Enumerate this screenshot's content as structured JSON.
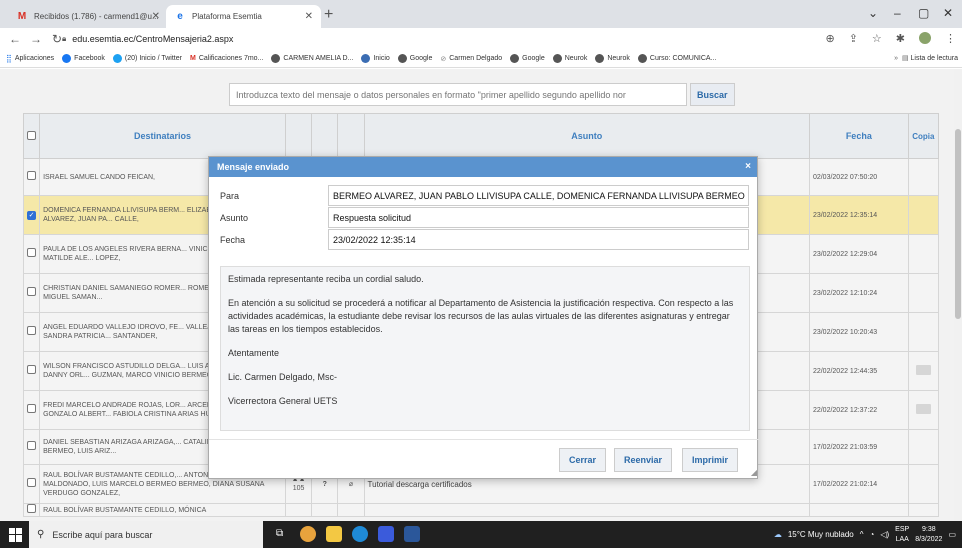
{
  "browser": {
    "tabs": [
      {
        "title": "Recibidos (1.786) - carmend1@u...",
        "active": false
      },
      {
        "title": "Plataforma Esemtia",
        "active": true
      }
    ],
    "url": "edu.esemtia.ec/CentroMensajeria2.aspx",
    "bookmarks": [
      "Aplicaciones",
      "Facebook",
      "(20) Inicio / Twitter",
      "Calificaciones 7mo...",
      "CARMEN AMELIA D...",
      "Inicio",
      "Google",
      "Carmen Delgado",
      "Google",
      "Neurok",
      "Neurok",
      "Curso: COMUNICA..."
    ],
    "reading_list": "Lista de lectura",
    "new_tab_symbol": "+",
    "window_controls": [
      "⌄",
      "–",
      "▢",
      "✕"
    ]
  },
  "search": {
    "placeholder": "Introduzca texto del mensaje o datos personales en formato \"primer apellido segundo apellido nor",
    "button": "Buscar"
  },
  "table": {
    "headers": {
      "recipients": "Destinatarios",
      "subject": "Asunto",
      "date": "Fecha",
      "copy": "Copia"
    },
    "rows": [
      {
        "names": "ISRAEL SAMUEL CANDO FEICAN,",
        "date": "02/03/2022 07:50:20",
        "selected": false,
        "env": false
      },
      {
        "names": "DOMENICA FERNANDA LLIVISUPA BERM... ELIZABETH BERMEO ALVAREZ, JUAN PA... CALLE,",
        "date": "23/02/2022 12:35:14",
        "selected": true,
        "env": false
      },
      {
        "names": "PAULA DE LOS ANGELES RIVERA BERNA... VINICIO RIVERA MEDINA, MATILDE ALE... LOPEZ,",
        "date": "23/02/2022 12:29:04",
        "selected": false,
        "env": false
      },
      {
        "names": "CHRISTIAN DANIEL SAMANIEGO ROMER... ROMERO LOJA, MARCO MIGUEL SAMAN...",
        "date": "23/02/2022 12:10:24",
        "selected": false,
        "env": false
      },
      {
        "names": "ANGEL EDUARDO VALLEJO IDROVO, FE... VALLEJO SIGUENCIA, SANDRA PATRICIA... SANTANDER,",
        "date": "23/02/2022 10:20:43",
        "selected": false,
        "env": false
      },
      {
        "names": "WILSON FRANCISCO ASTUDILLO DELGA... LUIS AVILA CAMPOVERDE, DANNY ORL... GUZMAN, MARCO VINICIO BERMEO DIA...",
        "date": "22/02/2022 12:44:35",
        "selected": false,
        "env": true
      },
      {
        "names": "FREDI MARCELO ANDRADE ROJAS, LOR... ARCENTALES AVILES, GONZALO ALBERT... FABIOLA CRISTINA ARIAS HUGO, WILSC...",
        "date": "22/02/2022 12:37:22",
        "selected": false,
        "env": true
      },
      {
        "names": "DANIEL SEBASTIAN ARIZAGA ARIZAGA,... CATALINA ARIZAGA BERMEO, LUIS ARIZ...",
        "date": "17/02/2022 21:03:59",
        "selected": false,
        "env": false
      },
      {
        "names": "RAUL BOLÍVAR BUSTAMANTE CEDILLO,... ANTONIA ARICHÁVALA MALDONADO, LUIS MARCELO BERMEO BERMEO, DIANA SUSANA VERDUGO GONZALEZ,",
        "date": "17/02/2022 21:02:14",
        "selected": false,
        "env": false,
        "count": "105",
        "subject": "Tutorial descarga certificados"
      },
      {
        "names": "RAUL BOLÍVAR BUSTAMANTE CEDILLO, MÓNICA",
        "date": "",
        "selected": false,
        "env": false
      }
    ]
  },
  "modal": {
    "title": "Mensaje enviado",
    "close": "×",
    "labels": {
      "to": "Para",
      "subject": "Asunto",
      "date": "Fecha"
    },
    "to": "BERMEO ALVAREZ, JUAN PABLO LLIVISUPA CALLE, DOMENICA FERNANDA LLIVISUPA BERMEO",
    "subject": "Respuesta solicitud",
    "date": "23/02/2022 12:35:14",
    "body": [
      "Estimada representante reciba un cordial saludo.",
      "En atención a su solicitud se procederá a notificar al Departamento de Asistencia la justificación respectiva. Con respecto a las actividades académicas, la estudiante debe revisar los recursos de las aulas virtuales de las diferentes asignaturas y entregar las tareas en los tiempos establecidos.",
      "Atentamente",
      "Lic. Carmen Delgado, Msc-",
      "Vicerrectora General UETS"
    ],
    "buttons": {
      "close": "Cerrar",
      "resend": "Reenviar",
      "print": "Imprimir"
    }
  },
  "taskbar": {
    "search_placeholder": "Escribe aquí para buscar",
    "weather": "15°C  Muy nublado",
    "lang": "ESP",
    "lang2": "LAA",
    "time": "9:38",
    "date": "8/3/2022"
  },
  "colors": {
    "modal_header": "#5a93cf",
    "selected_row": "#f5e8a8",
    "link_blue": "#2c6aa8"
  }
}
